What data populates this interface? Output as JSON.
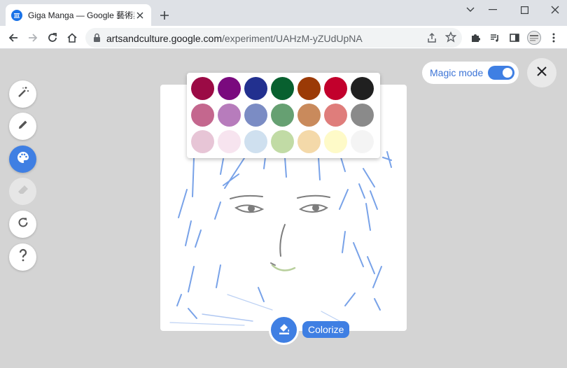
{
  "browser": {
    "tab_title": "Giga Manga — Google 藝術與文",
    "url_host": "artsandculture.google.com",
    "url_path": "/experiment/UAHzM-yZUdUpNA"
  },
  "palette": {
    "colors": [
      [
        "#9b0a45",
        "#7a0a7e",
        "#22308f",
        "#08602f",
        "#9b3a06",
        "#c2002c",
        "#202020"
      ],
      [
        "#c4678e",
        "#b77cbc",
        "#7b8cc4",
        "#66a072",
        "#c98a5c",
        "#df7d7b",
        "#8a8a8a"
      ],
      [
        "#e7c5d6",
        "#f7e4ef",
        "#cfe0ef",
        "#c1dba5",
        "#f4d9a9",
        "#fefac8",
        "#f4f4f4"
      ]
    ]
  },
  "magic_mode": {
    "label": "Magic mode",
    "enabled": true
  },
  "colorize": {
    "label": "Colorize"
  },
  "tools": [
    "magic-wand-icon",
    "pencil-icon",
    "palette-icon",
    "eraser-icon",
    "refresh-icon",
    "help-icon"
  ]
}
